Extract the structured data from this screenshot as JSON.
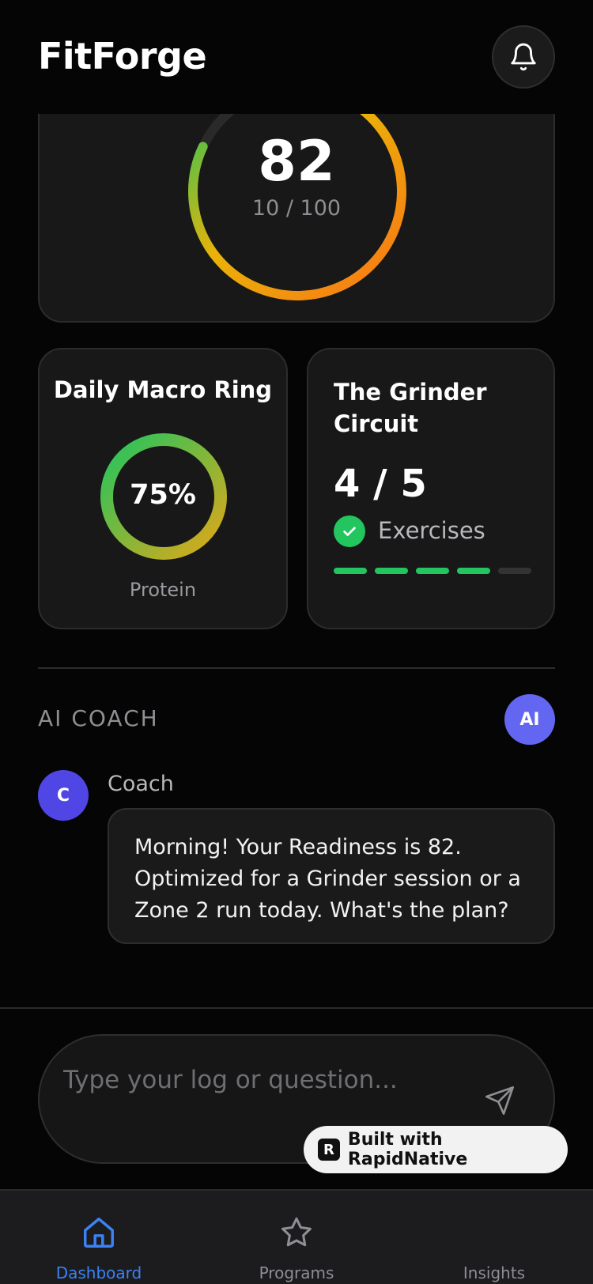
{
  "header": {
    "title": "FitForge",
    "bell_icon": "bell-icon"
  },
  "readiness": {
    "score": "82",
    "sub": "10 / 100",
    "progress_fraction": 0.82
  },
  "macro": {
    "title": "Daily Macro Ring",
    "percent": "75%",
    "label": "Protein",
    "progress_fraction": 1.0
  },
  "grinder": {
    "title": "The Grinder Circuit",
    "count": "4 / 5",
    "label": "Exercises",
    "completed": 4,
    "total": 5
  },
  "coach_section": {
    "label": "AI COACH",
    "badge": "AI"
  },
  "message": {
    "avatar": "C",
    "sender": "Coach",
    "text": "Morning! Your Readiness is 82. Optimized for a Grinder session or a Zone 2 run today. What's the plan?"
  },
  "composer": {
    "placeholder": "Type your log or question...",
    "send_icon": "send-icon"
  },
  "built_badge": {
    "logo": "R",
    "text": "Built with RapidNative"
  },
  "tabs": [
    {
      "label": "Dashboard",
      "icon": "home-icon",
      "active": true
    },
    {
      "label": "Programs",
      "icon": "star-icon",
      "active": false
    },
    {
      "label": "Insights",
      "icon": "chart-icon",
      "active": false
    }
  ],
  "colors": {
    "background": "#050505",
    "card": "#181818",
    "accent": "#3b82f6",
    "success": "#22c55e",
    "coach": "#4f46e5",
    "ai_badge": "#6366f1",
    "ring_orange": "#f97316",
    "ring_green": "#22c55e"
  }
}
